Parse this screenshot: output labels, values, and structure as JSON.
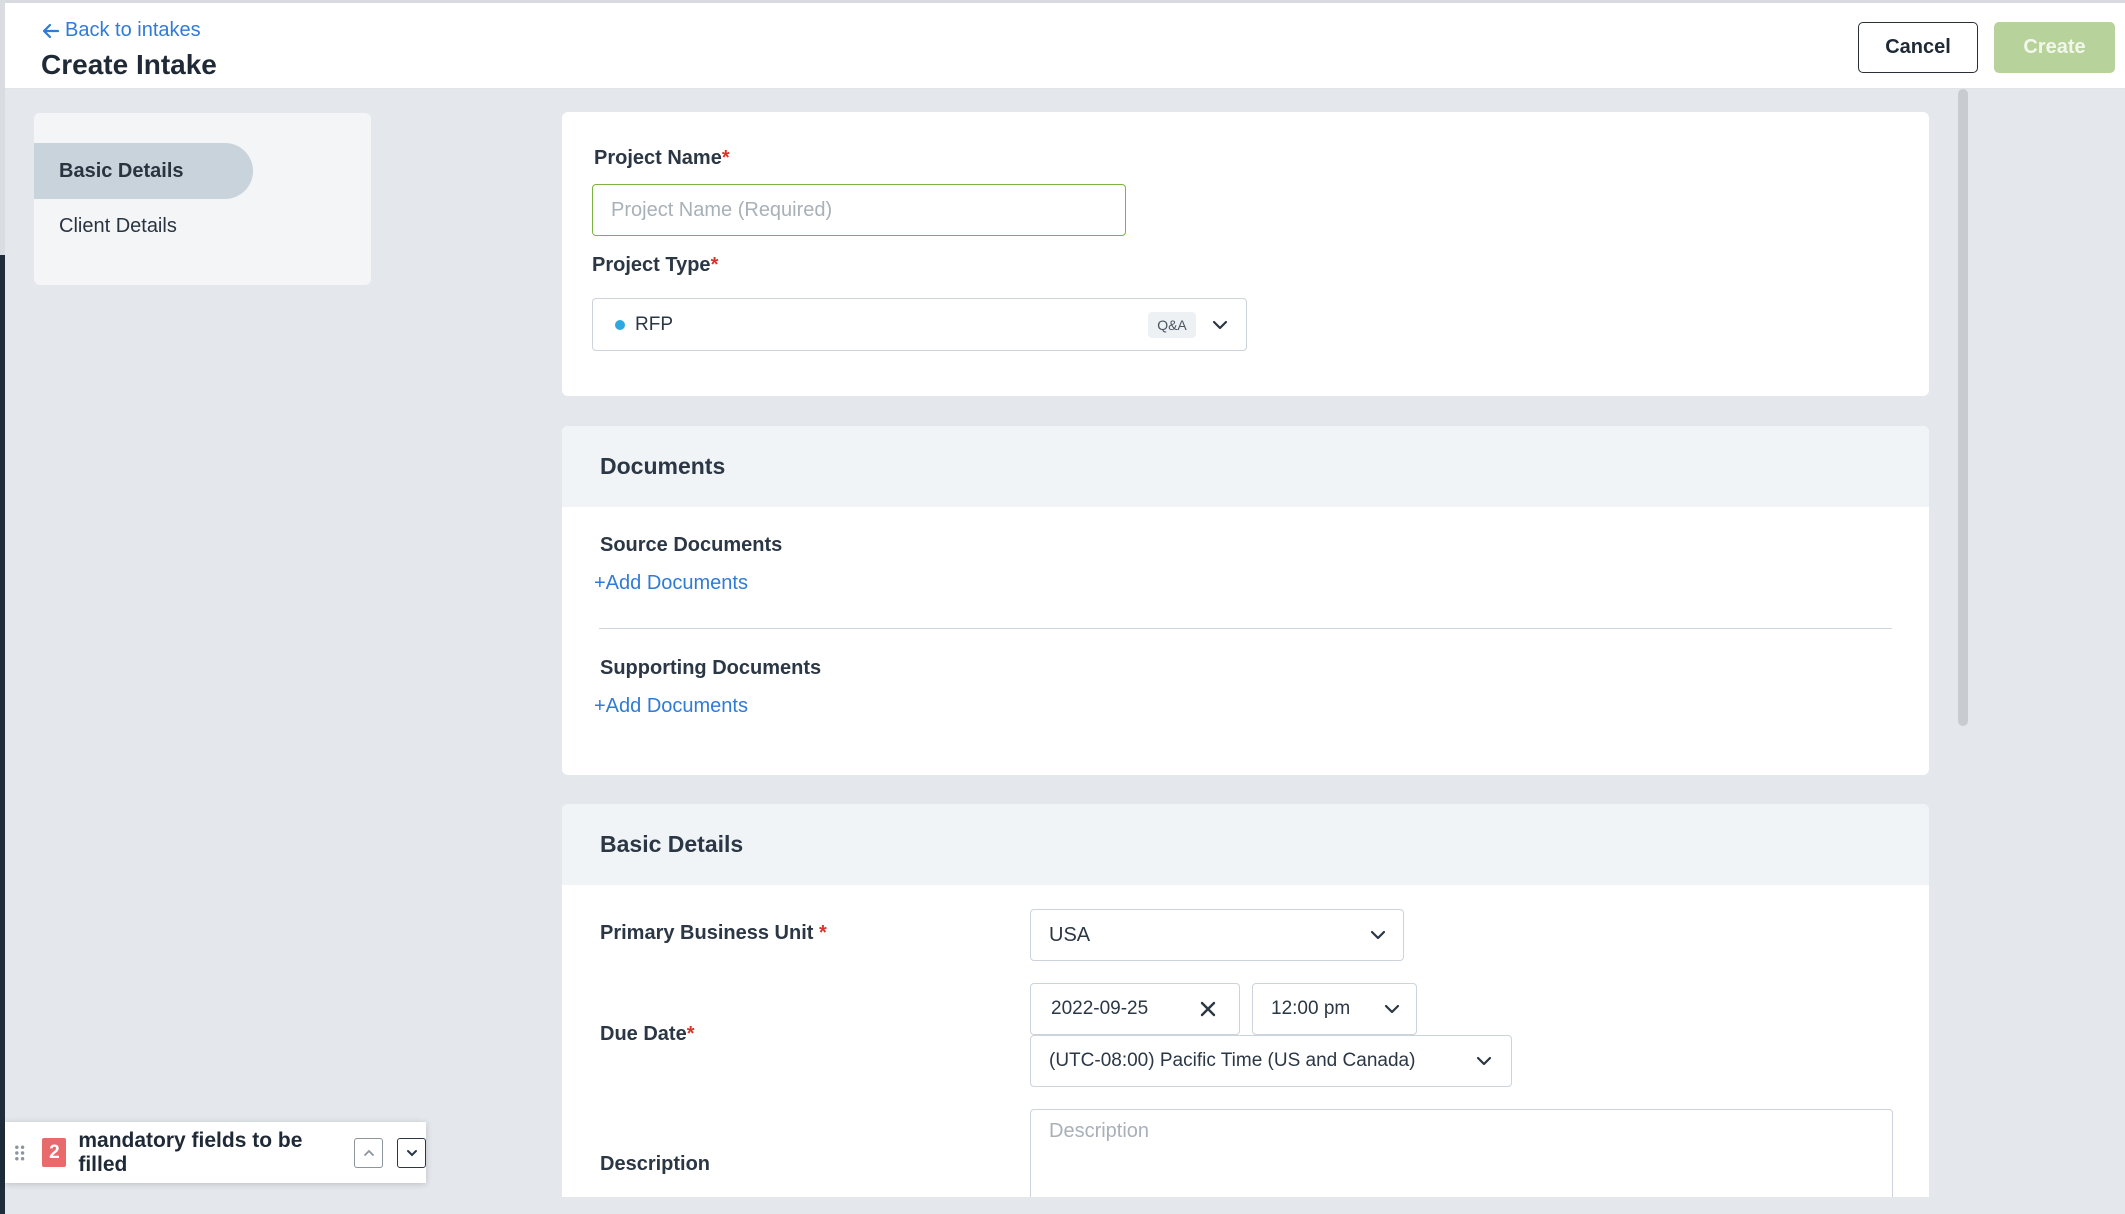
{
  "header": {
    "back_label": "Back to intakes",
    "title": "Create Intake",
    "cancel_label": "Cancel",
    "create_label": "Create"
  },
  "side_nav": {
    "items": [
      {
        "label": "Basic Details",
        "active": true
      },
      {
        "label": "Client Details",
        "active": false
      }
    ]
  },
  "project": {
    "name_label": "Project Name",
    "name_placeholder": "Project Name (Required)",
    "type_label": "Project Type",
    "type_value": "RFP",
    "type_tag": "Q&A",
    "required_mark": "*"
  },
  "documents": {
    "title": "Documents",
    "source_label": "Source Documents",
    "source_add": "+Add Documents",
    "supporting_label": "Supporting Documents",
    "supporting_add": "+Add Documents"
  },
  "basic_details": {
    "title": "Basic Details",
    "business_unit_label": "Primary Business Unit",
    "business_unit_value": "USA",
    "due_date_label": "Due Date",
    "due_date_value": "2022-09-25",
    "due_time_value": "12:00 pm",
    "timezone_value": "(UTC-08:00) Pacific Time (US and Canada)",
    "description_label": "Description",
    "description_placeholder": "Description"
  },
  "status": {
    "count": "2",
    "text": "mandatory fields to be filled"
  },
  "colors": {
    "accent": "#2f7bd8",
    "create_disabled": "#b7d29a",
    "badge": "#e86a6a",
    "focus_border": "#7cb342",
    "type_dot": "#2ea8e0"
  }
}
